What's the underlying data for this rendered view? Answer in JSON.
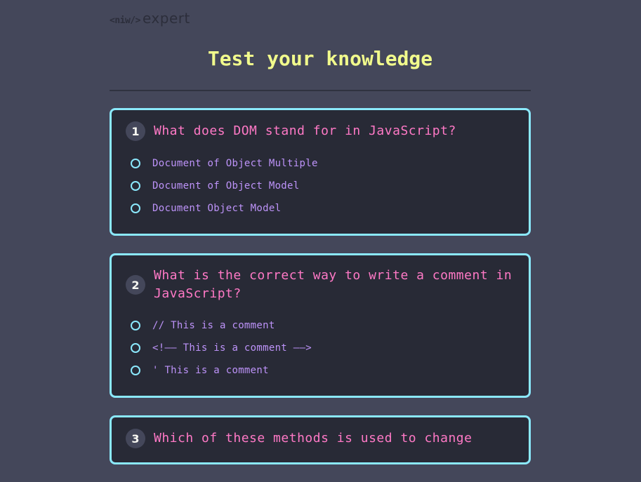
{
  "brand": {
    "code": "<niw/>",
    "word": "expert"
  },
  "page_title": "Test your knowledge",
  "questions": [
    {
      "number": "1",
      "text": "What does DOM stand for in JavaScript?",
      "options": [
        "Document of Object Multiple",
        "Document of Object Model",
        "Document Object Model"
      ]
    },
    {
      "number": "2",
      "text": "What is the correct way to write a comment in JavaScript?",
      "options": [
        "// This is a comment",
        "<!—— This is a comment ——>",
        "' This is a comment"
      ]
    },
    {
      "number": "3",
      "text": "Which of these methods is used to change",
      "options": []
    }
  ],
  "colors": {
    "background": "#44475a",
    "card": "#282a36",
    "card_border": "#8be9fd",
    "title": "#f1fa8c",
    "question": "#ff79c6",
    "option": "#bd93f9"
  }
}
